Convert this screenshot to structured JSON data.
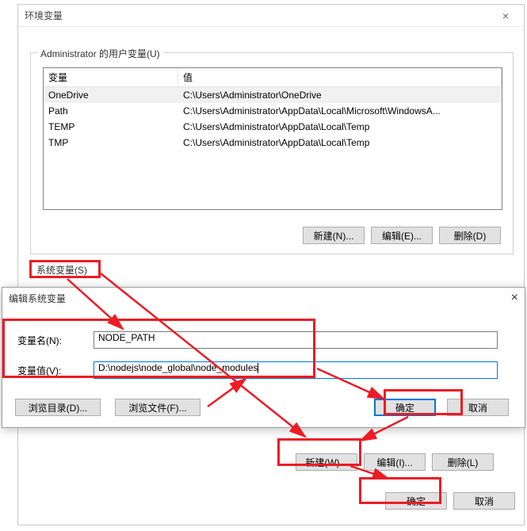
{
  "main_dialog": {
    "title": "环境变量",
    "close_icon": "×"
  },
  "user_section": {
    "legend": "Administrator 的用户变量(U)",
    "headers": {
      "var": "变量",
      "val": "值"
    },
    "rows": [
      {
        "var": "OneDrive",
        "val": "C:\\Users\\Administrator\\OneDrive"
      },
      {
        "var": "Path",
        "val": "C:\\Users\\Administrator\\AppData\\Local\\Microsoft\\WindowsA..."
      },
      {
        "var": "TEMP",
        "val": "C:\\Users\\Administrator\\AppData\\Local\\Temp"
      },
      {
        "var": "TMP",
        "val": "C:\\Users\\Administrator\\AppData\\Local\\Temp"
      }
    ],
    "buttons": {
      "new": "新建(N)...",
      "edit": "编辑(E)...",
      "del": "删除(D)"
    }
  },
  "sys_section": {
    "legend": "系统变量(S)",
    "buttons": {
      "new": "新建(W)...",
      "edit": "编辑(I)...",
      "del": "删除(L)"
    }
  },
  "final_buttons": {
    "ok": "确定",
    "cancel": "取消"
  },
  "edit_dialog": {
    "title": "编辑系统变量",
    "close_icon": "×",
    "name_label": "变量名(N):",
    "name_value": "NODE_PATH",
    "val_label": "变量值(V):",
    "val_value": "D:\\nodejs\\node_global\\node_modules",
    "browse_dir": "浏览目录(D)...",
    "browse_file": "浏览文件(F)...",
    "ok": "确定",
    "cancel": "取消"
  },
  "annotations": {
    "color": "#ec1c24"
  }
}
